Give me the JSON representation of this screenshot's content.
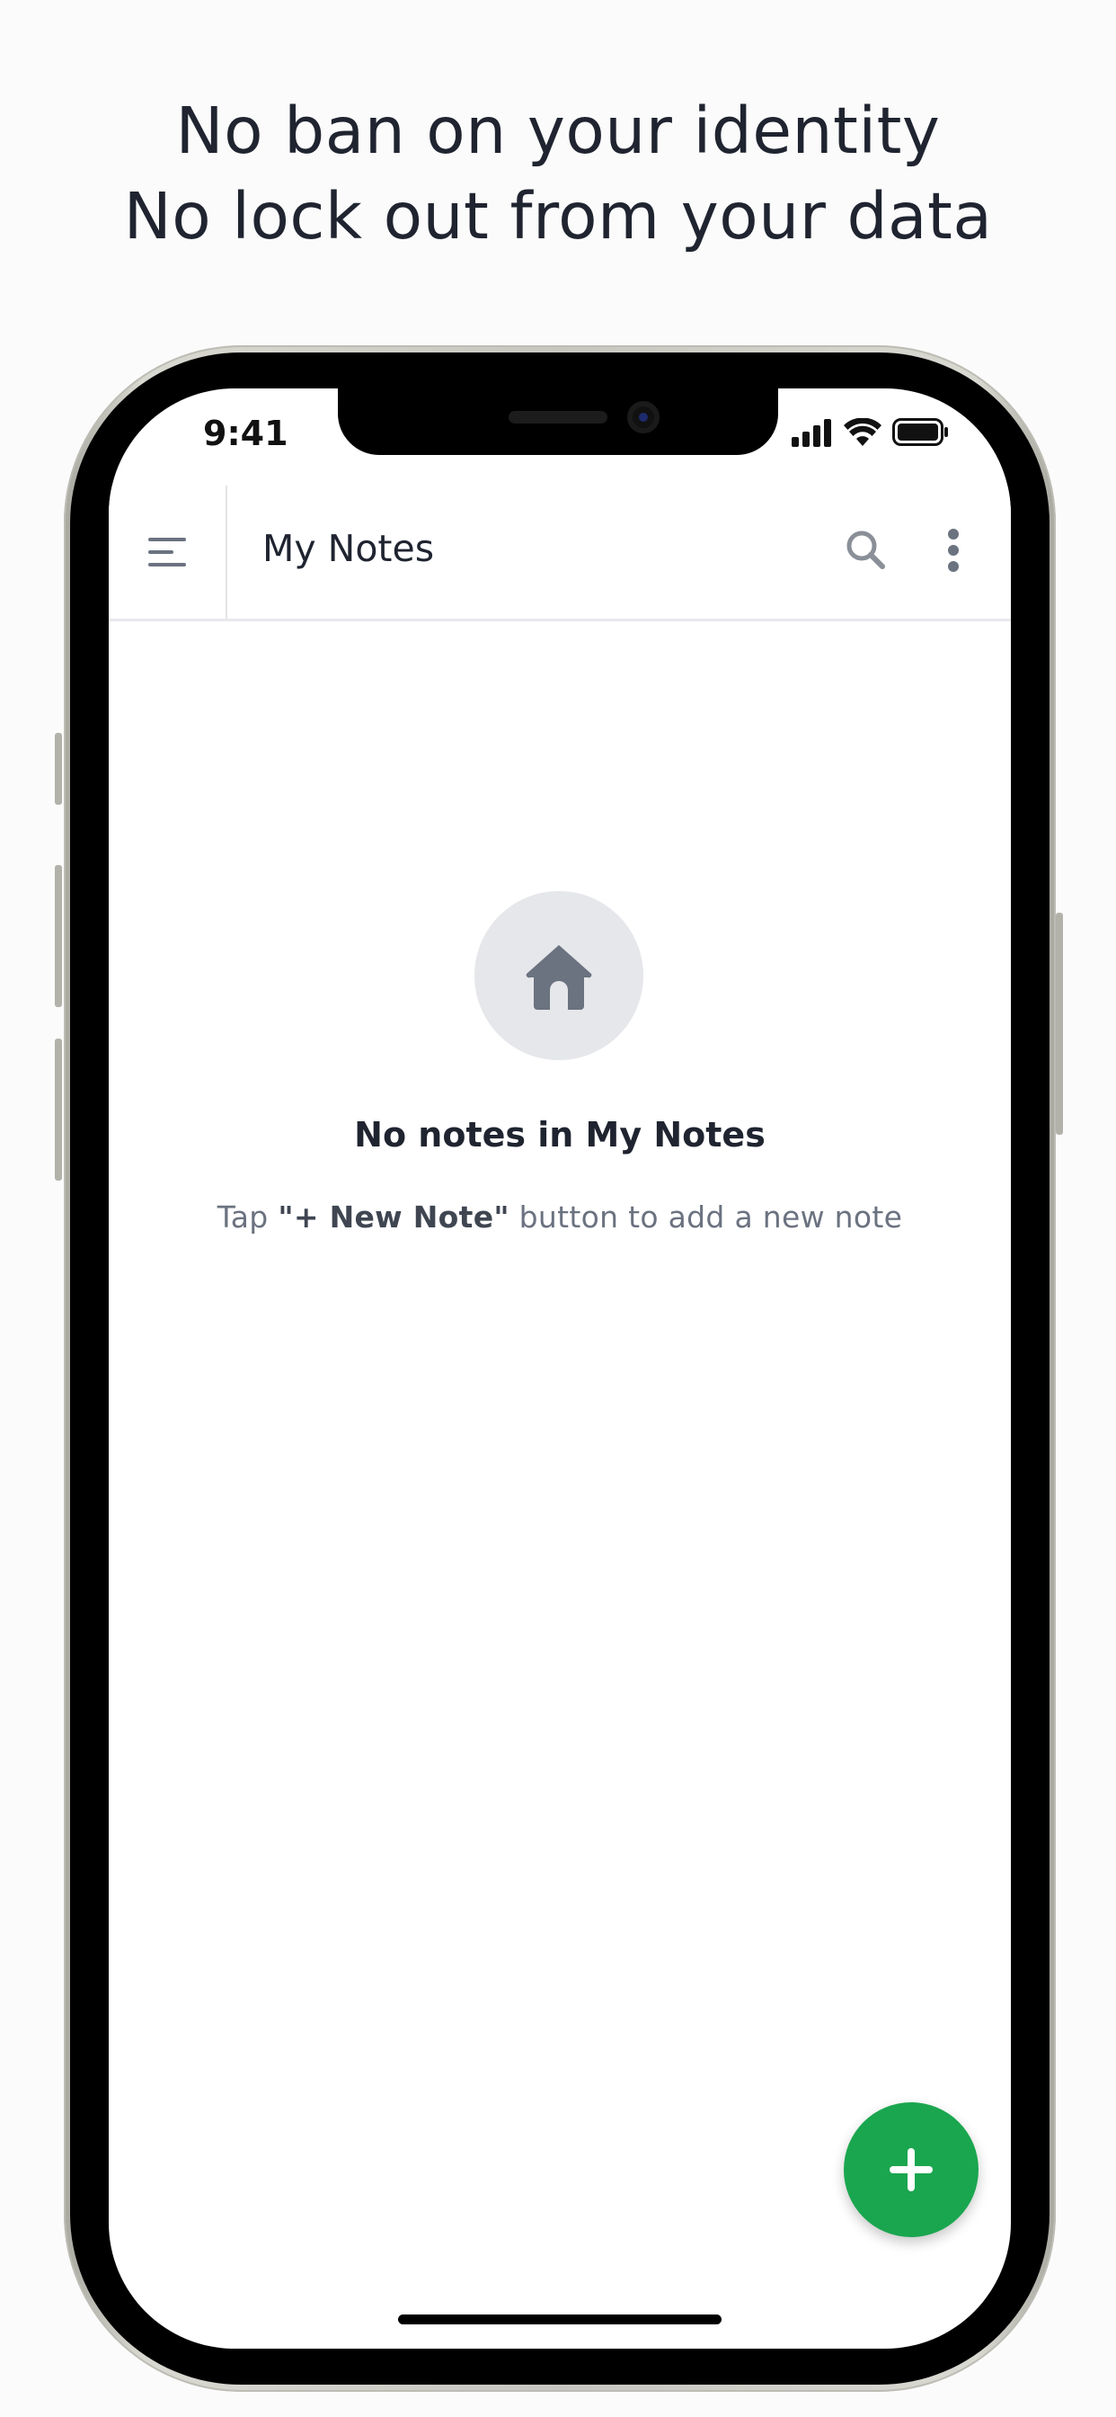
{
  "headline": {
    "line1": "No ban on your identity",
    "line2": "No lock out from your data"
  },
  "status_bar": {
    "time": "9:41",
    "icons": [
      "cellular-signal-icon",
      "wifi-icon",
      "battery-icon"
    ]
  },
  "app_bar": {
    "title": "My Notes",
    "menu_icon": "menu-icon",
    "search_icon": "search-icon",
    "more_icon": "more-vertical-icon"
  },
  "empty_state": {
    "icon": "home-icon",
    "title": "No notes in My Notes",
    "hint_prefix": "Tap ",
    "hint_emphasis": "\"+ New Note\"",
    "hint_suffix": " button to add a new note"
  },
  "fab": {
    "icon": "plus-icon"
  },
  "colors": {
    "accent": "#1aa64f",
    "text_primary": "#1f2430",
    "text_secondary": "#6b7280",
    "icon_gray": "#6b7280"
  }
}
